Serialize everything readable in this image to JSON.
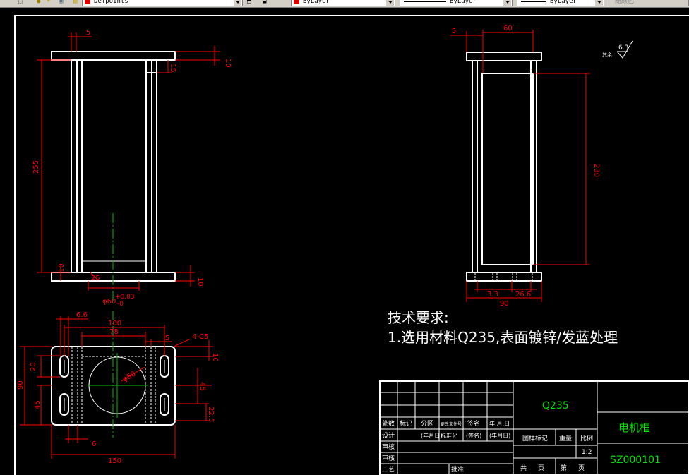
{
  "toolbar": {
    "layer_name": "Defpoints",
    "color_value": "ByLayer",
    "linetype_value": "ByLayer",
    "lineweight_value": "ByLayer",
    "plotstyle_value": "随颜色"
  },
  "dims": {
    "front": {
      "d5": "5",
      "d10": "10",
      "d15": "15",
      "d255": "255",
      "d10b": "10",
      "d10c": "10",
      "d25": "25",
      "dia_prefix": "φ60",
      "tol_plus": "+0.03",
      "tol_minus": "-0"
    },
    "side": {
      "d5": "5",
      "d60": "60",
      "d230": "230",
      "d33": "3.3",
      "d266": "26.6",
      "d90": "90"
    },
    "plan": {
      "d66": "6.6",
      "d100": "100",
      "d78": "78",
      "d5": "5",
      "chamfer": "4-C5",
      "d10": "10",
      "d20": "20",
      "d90": "90",
      "d45a": "45",
      "d45b": "45",
      "d225": "22.5",
      "d6": "6",
      "d150": "150",
      "dia": "φ50"
    },
    "roughness": {
      "label": "其余",
      "value": "6.3"
    }
  },
  "notes": {
    "heading": "技术要求:",
    "line1": "1.选用材料Q235,表面镀锌/发蓝处理"
  },
  "title_block": {
    "material": "Q235",
    "part_name": "电机框",
    "drawing_no": "SZ000101",
    "h_chuli": "处数",
    "h_biaoji": "标记",
    "h_fenqu": "分区",
    "h_genggai": "更改文件号",
    "h_qianming": "签名",
    "h_nianyueri": "年,月,日",
    "sheji": "设计",
    "nianyueri1": "(年月日)",
    "biaozhunhua": "标准化",
    "qianming2": "(签名)",
    "nianyueri2": "(年月日)",
    "tuyang": "图样标记",
    "zhongliang": "重量",
    "bili": "比例",
    "scale": "1:2",
    "jiaodui": "审核",
    "shenhe": "审核",
    "gongyi": "工艺",
    "pizhun": "批准",
    "gong": "共",
    "zhang1": "页",
    "di": "第",
    "zhang2": "页"
  }
}
